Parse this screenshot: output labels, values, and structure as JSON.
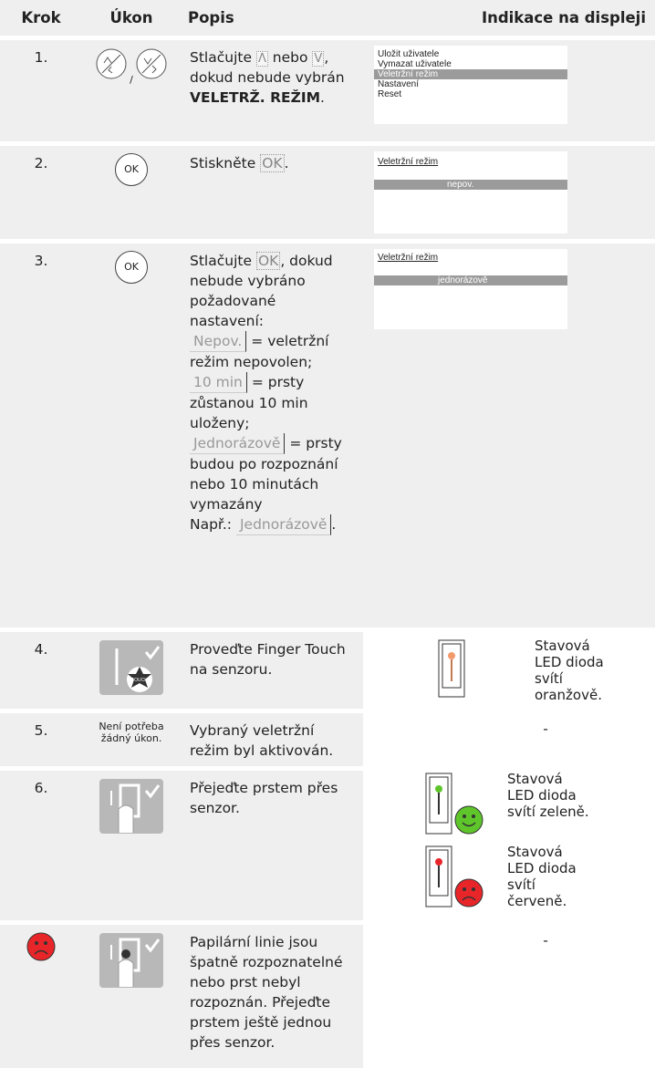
{
  "headers": {
    "step": "Krok",
    "action": "Úkon",
    "description": "Popis",
    "display": "Indikace na displeji"
  },
  "rows": {
    "r1": {
      "step": "1.",
      "desc_a": "Stlačujte",
      "key_up": "Λ",
      "desc_b": "nebo",
      "key_down": "V",
      "desc_c": ",",
      "desc_d": "dokud nebude vybrán",
      "bold": "VELETRŽ. REŽIM",
      "desc_e": ".",
      "slash": "/",
      "menu": [
        "Uložit uživatele",
        "Vymazat uživatele",
        "Veletržní režim",
        "Nastavení",
        "Reset"
      ],
      "menu_selected": "Veletržní režim"
    },
    "r2": {
      "step": "2.",
      "button": "OK",
      "desc": "Stiskněte",
      "key": "OK",
      "end": ".",
      "screen_title": "Veletržní režim",
      "screen_value": "nepov."
    },
    "r3": {
      "step": "3.",
      "button": "OK",
      "desc_a": "Stlačujte",
      "key": "OK",
      "desc_b": ", dokud nebude vybráno požadované nastavení:",
      "opt1": "Nepov.",
      "opt1_txt": "= veletržní režim nepovolen;",
      "opt2": "10 min",
      "opt2_txt": "= prsty zůstanou 10 min uloženy;",
      "opt3": "Jednorázově",
      "opt3_txt": "= prsty budou po rozpoznání nebo 10 minutách vymazány",
      "ex": "Např.:",
      "ex_val": "Jednorázově",
      "end": ".",
      "screen_title": "Veletržní režim",
      "screen_value": "jednorázově"
    },
    "r4": {
      "step": "4.",
      "icon_text": "TOUCH",
      "desc": "Proveďte Finger Touch na senzoru.",
      "led": "Stavová LED dioda svítí oranžově.",
      "led_color": "#f39a6b"
    },
    "r5": {
      "step": "5.",
      "action": "Není potřeba žádný úkon.",
      "desc": "Vybraný veletržní režim byl aktivován.",
      "display": "-"
    },
    "r6": {
      "step": "6.",
      "desc": "Přejeďte prstem přes senzor.",
      "led_green": "Stavová LED dioda svítí zeleně.",
      "led_red": "Stavová LED dioda svítí červeně.",
      "green": "#5ec52b",
      "red": "#e8262a"
    },
    "r7": {
      "desc": "Papilární linie jsou špatně rozpoznatelné nebo prst nebyl rozpoznán. Přejeďte prstem ještě jednou přes senzor.",
      "display": "-"
    }
  }
}
